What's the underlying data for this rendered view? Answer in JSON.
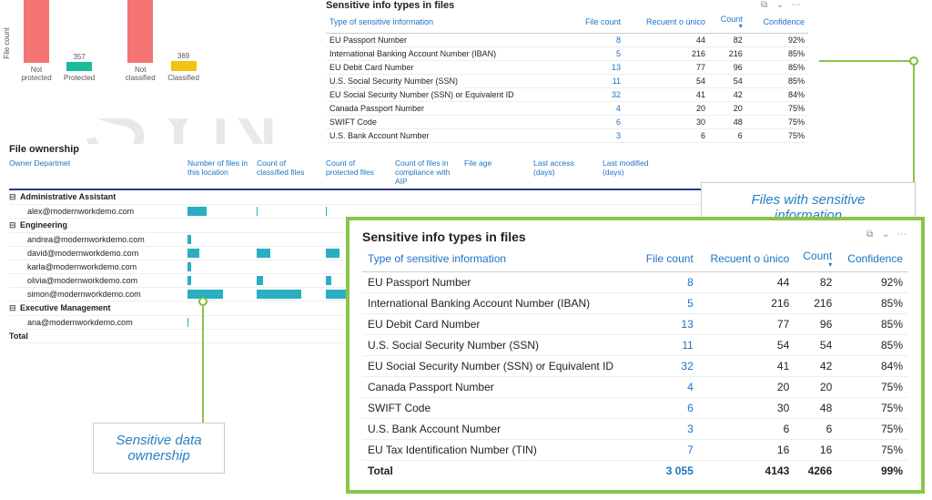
{
  "background_text": "SYN",
  "chart_data": [
    {
      "type": "bar",
      "ylabel": "File count",
      "ylim": [
        0,
        2800
      ],
      "categories": [
        "Not protected",
        "Protected"
      ],
      "values": [
        2698,
        357
      ],
      "colors": [
        "#f47373",
        "#1abc9c"
      ]
    },
    {
      "type": "bar",
      "ylabel": "",
      "ylim": [
        0,
        2800
      ],
      "categories": [
        "Not classified",
        "Classified"
      ],
      "values": [
        2686,
        369
      ],
      "colors": [
        "#f47373",
        "#f1c40f"
      ]
    }
  ],
  "sens_table": {
    "title": "Sensitive info types in files",
    "headers": [
      "Type of sensitive information",
      "File count",
      "Recuent o único",
      "Count",
      "Confidence"
    ],
    "sort_col": 3,
    "rows": [
      [
        "EU Passport Number",
        "8",
        "44",
        "82",
        "92%"
      ],
      [
        "International Banking Account Number (IBAN)",
        "5",
        "216",
        "216",
        "85%"
      ],
      [
        "EU Debit Card Number",
        "13",
        "77",
        "96",
        "85%"
      ],
      [
        "U.S. Social Security Number (SSN)",
        "11",
        "54",
        "54",
        "85%"
      ],
      [
        "EU Social Security Number (SSN) or Equivalent ID",
        "32",
        "41",
        "42",
        "84%"
      ],
      [
        "Canada Passport Number",
        "4",
        "20",
        "20",
        "75%"
      ],
      [
        "SWIFT Code",
        "6",
        "30",
        "48",
        "75%"
      ],
      [
        "U.S. Bank Account Number",
        "3",
        "6",
        "6",
        "75%"
      ],
      [
        "EU Tax Identification Number (TIN)",
        "7",
        "16",
        "16",
        "75%"
      ]
    ],
    "total": [
      "Total",
      "3 055",
      "4143",
      "4266",
      "99%"
    ]
  },
  "ownership": {
    "title": "File ownership",
    "headers": [
      "Owner Departmet",
      "Number of files in this location",
      "Count of classified files",
      "Count of protected files",
      "Count of files in compliance with AIP",
      "File age",
      "Last access (days)",
      "Last modified (days)"
    ],
    "groups": [
      {
        "name": "Administrative Assistant",
        "rows": [
          {
            "email": "alex@modernworkdemo.com",
            "bars": [
              0.3,
              0.02,
              0.01
            ]
          }
        ]
      },
      {
        "name": "Engineering",
        "rows": [
          {
            "email": "andrea@modernworkdemo.com",
            "bars": [
              0.05,
              0.0,
              0.0
            ]
          },
          {
            "email": "david@modernworkdemo.com",
            "bars": [
              0.18,
              0.22,
              0.22
            ]
          },
          {
            "email": "karla@modernworkdemo.com",
            "bars": [
              0.05,
              0.0,
              0.0
            ]
          },
          {
            "email": "olivia@modernworkdemo.com",
            "bars": [
              0.06,
              0.1,
              0.08
            ]
          },
          {
            "email": "simon@modernworkdemo.com",
            "bars": [
              0.55,
              0.7,
              0.55
            ]
          }
        ]
      },
      {
        "name": "Executive Management",
        "rows": [
          {
            "email": "ana@modernworkdemo.com",
            "bars": [
              0.02,
              0.0,
              0.0
            ]
          }
        ]
      }
    ],
    "total_label": "Total"
  },
  "callouts": {
    "ownership": "Sensitive data ownership",
    "sensitive": "Files with sensitive information"
  },
  "icons": {
    "focus": "⧉",
    "filter": "⌄",
    "more": "⋯"
  }
}
